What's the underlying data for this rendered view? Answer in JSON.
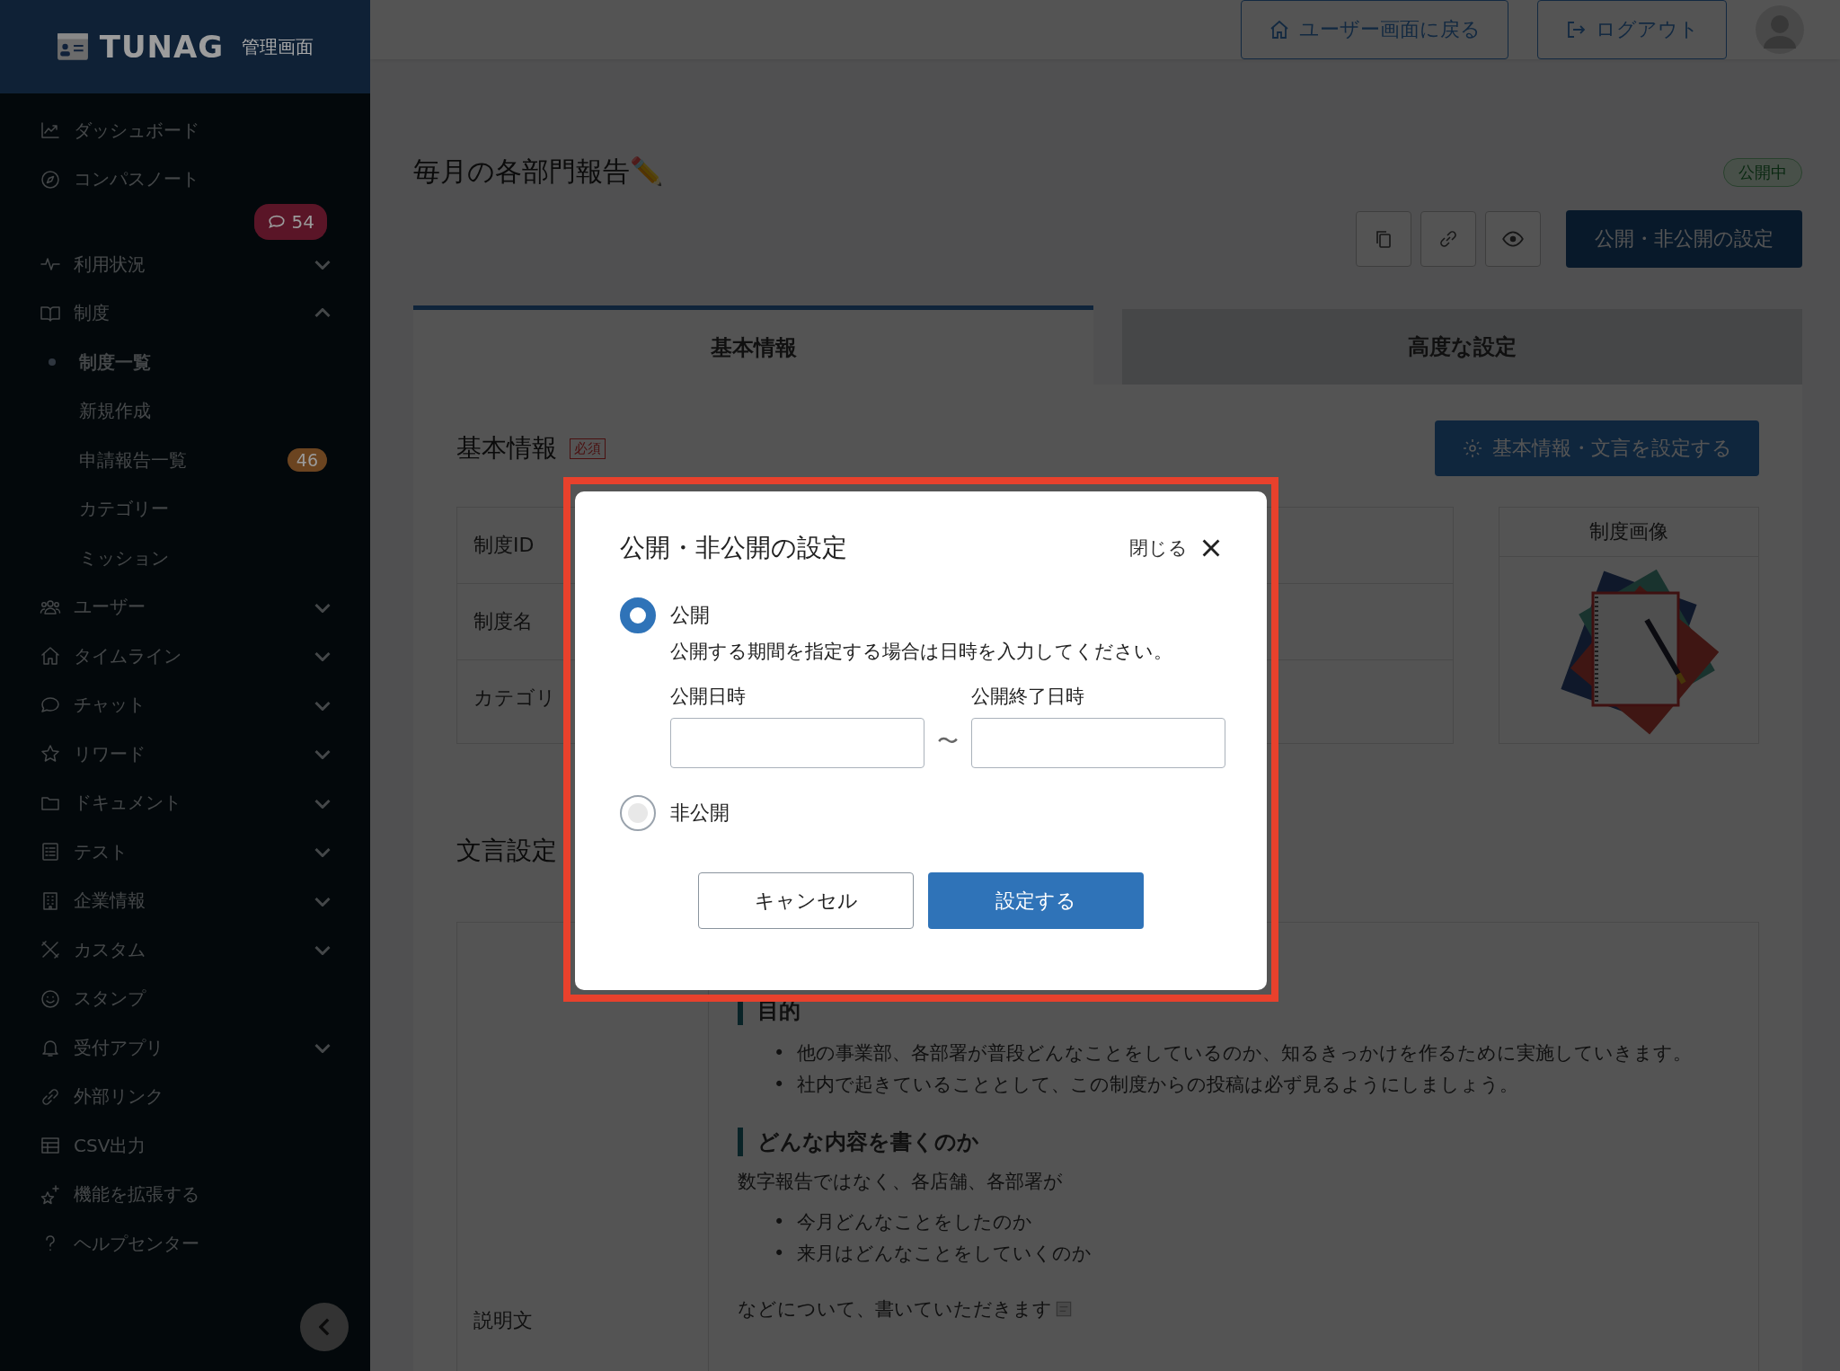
{
  "sidebar": {
    "logo": {
      "name": "TUNAG",
      "subtitle": "管理画面"
    },
    "items": [
      {
        "label": "ダッシュボード"
      },
      {
        "label": "コンパスノート",
        "badge": {
          "text": "54",
          "color": "#5a1527"
        }
      },
      {
        "label": "利用状況",
        "expanded": false
      },
      {
        "label": "制度",
        "expanded": true,
        "children": [
          {
            "label": "制度一覧",
            "selected": true
          },
          {
            "label": "新規作成",
            "selected": false
          },
          {
            "label": "申請報告一覧",
            "selected": false,
            "badge": {
              "text": "46",
              "color": "#6b4420"
            }
          },
          {
            "label": "カテゴリー",
            "selected": false
          },
          {
            "label": "ミッション",
            "selected": false
          }
        ]
      },
      {
        "label": "ユーザー",
        "expanded": false
      },
      {
        "label": "タイムライン",
        "expanded": false
      },
      {
        "label": "チャット",
        "expanded": false
      },
      {
        "label": "リワード",
        "expanded": false
      },
      {
        "label": "ドキュメント",
        "expanded": false
      },
      {
        "label": "テスト",
        "expanded": false
      },
      {
        "label": "企業情報",
        "expanded": false
      },
      {
        "label": "カスタム",
        "expanded": false
      },
      {
        "label": "スタンプ"
      },
      {
        "label": "受付アプリ",
        "expanded": false
      },
      {
        "label": "外部リンク"
      },
      {
        "label": "CSV出力"
      },
      {
        "label": "機能を拡張する"
      },
      {
        "label": "ヘルプセンター"
      }
    ]
  },
  "header": {
    "buttons": [
      "ユーザー画面に戻る",
      "ログアウト"
    ]
  },
  "page": {
    "title": "毎月の各部門報告✏️",
    "status": "公開中",
    "primary_button": "公開・非公開の設定",
    "tabs": [
      {
        "label": "基本情報",
        "selected": true
      },
      {
        "label": "高度な設定",
        "selected": false
      }
    ],
    "basic": {
      "heading": "基本情報",
      "required_tag": "必須",
      "edit_button": "基本情報・文言を設定する",
      "rows": [
        "制度ID",
        "制度名",
        "カテゴリ"
      ],
      "image_heading": "制度画像"
    },
    "text_settings": {
      "heading": "文言設定",
      "label": "説明文",
      "blocks": [
        {
          "kind": "heading",
          "text": "目的"
        },
        {
          "kind": "bullets",
          "marker": "•",
          "items": [
            "他の事業部、各部署が普段どんなことをしているのか、知るきっかけを作るために実施していきます。",
            "社内で起きていることとして、この制度からの投稿は必ず見るようにしましょう。"
          ]
        },
        {
          "kind": "heading",
          "text": "どんな内容を書くのか"
        },
        {
          "kind": "paragraph",
          "text": "数字報告ではなく、各店舗、各部署が"
        },
        {
          "kind": "bullets",
          "marker": "•",
          "items": [
            "今月どんなことをしたのか",
            "来月はどんなことをしていくのか"
          ]
        },
        {
          "kind": "paragraph",
          "text": "などについて、書いていただきます"
        }
      ]
    }
  },
  "modal": {
    "title": "公開・非公開の設定",
    "close_label": "閉じる",
    "options": [
      {
        "label": "公開",
        "selected": true,
        "note": "公開する期間を指定する場合は日時を入力してください。",
        "fields": [
          {
            "label": "公開日時"
          },
          {
            "label": "公開終了日時"
          }
        ],
        "separator": "〜"
      },
      {
        "label": "非公開",
        "selected": false
      }
    ],
    "buttons": {
      "cancel": "キャンセル",
      "submit": "設定する"
    }
  }
}
